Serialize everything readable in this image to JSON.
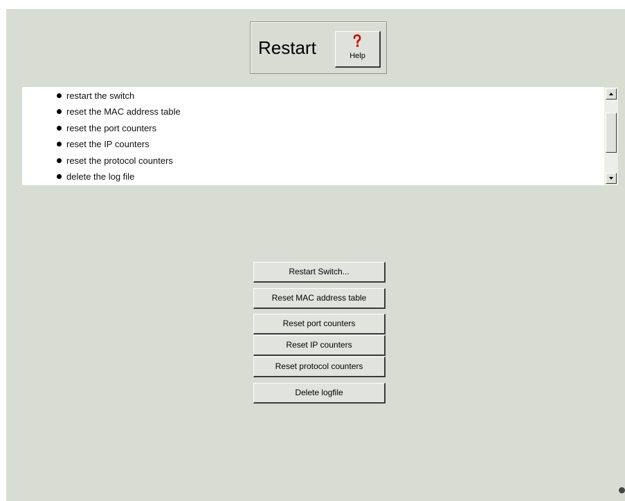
{
  "header": {
    "title": "Restart",
    "help_label": "Help"
  },
  "info_list": {
    "items": [
      "restart the switch",
      "reset the MAC address table",
      "reset the port counters",
      "reset the IP counters",
      "reset the protocol counters",
      "delete the log file"
    ]
  },
  "actions": {
    "restart_switch": "Restart Switch...",
    "reset_mac_table": "Reset MAC address table",
    "reset_port_counters": "Reset port counters",
    "reset_ip_counters": "Reset IP counters",
    "reset_protocol_counters": "Reset protocol counters",
    "delete_logfile": "Delete logfile"
  },
  "icons": {
    "help": "question-mark-icon",
    "scroll_up": "arrow-up-icon",
    "scroll_down": "arrow-down-icon",
    "status": "status-dot-icon"
  },
  "colors": {
    "background": "#d8dcd3",
    "list_background": "#ffffff",
    "help_icon": "#cc0000"
  }
}
